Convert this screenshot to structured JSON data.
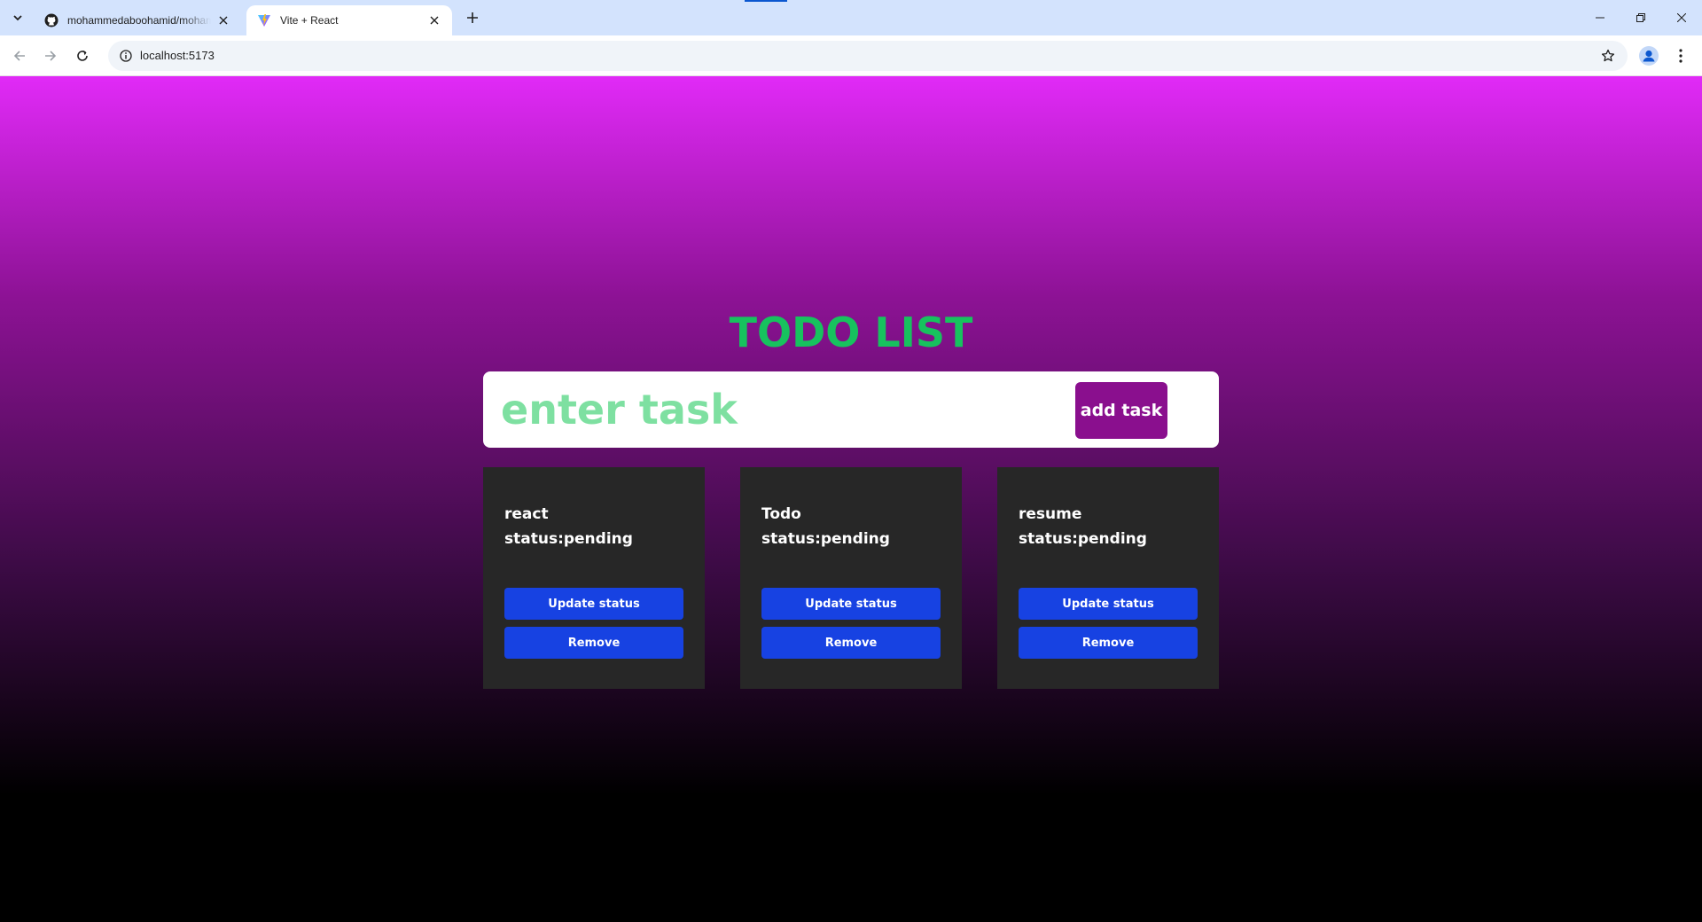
{
  "browser": {
    "tabs": [
      {
        "title": "mohammedaboohamid/mohammedaboohamid",
        "favicon": "github-icon"
      },
      {
        "title": "Vite + React",
        "favicon": "vite-icon",
        "active": true
      }
    ],
    "url": "localhost:5173"
  },
  "app": {
    "title": "TODO LIST",
    "input_placeholder": "enter task",
    "input_value": "",
    "add_button_label": "add task",
    "colors": {
      "title": "#17c25e",
      "placeholder": "#7ee0a1",
      "add_button": "#8a0f8e",
      "card_bg": "#272727",
      "card_button": "#1742e2",
      "gradient_top": "#e12af7",
      "gradient_bottom": "#000000"
    }
  },
  "tasks": [
    {
      "name": "react",
      "status": "status:pending",
      "update_label": "Update status",
      "remove_label": "Remove"
    },
    {
      "name": "Todo",
      "status": "status:pending",
      "update_label": "Update status",
      "remove_label": "Remove"
    },
    {
      "name": "resume",
      "status": "status:pending",
      "update_label": "Update status",
      "remove_label": "Remove"
    }
  ]
}
